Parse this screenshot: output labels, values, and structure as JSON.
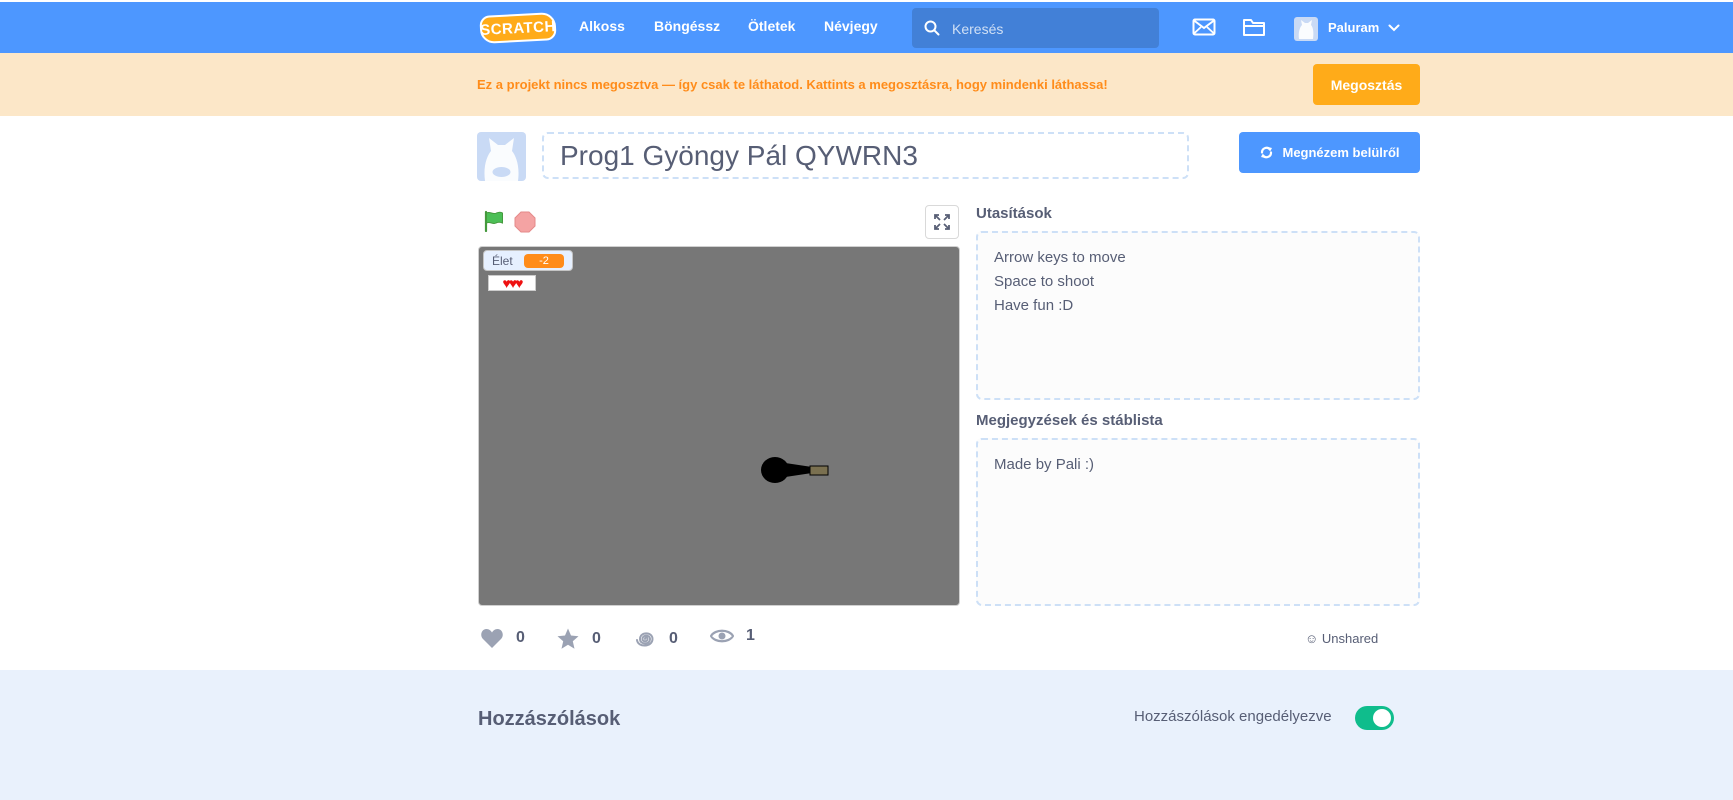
{
  "nav": {
    "logo_text": "SCRATCH",
    "links": [
      "Alkoss",
      "Böngéssz",
      "Ötletek",
      "Névjegy"
    ],
    "search_placeholder": "Keresés",
    "username": "Paluram",
    "icons": [
      "search-icon",
      "mail-icon",
      "folder-icon",
      "chevron-down-icon"
    ]
  },
  "banner": {
    "text": "Ez a projekt nincs megosztva — így csak te láthatod. Kattints a megosztásra, hogy mindenki láthassa!",
    "share_label": "Megosztás"
  },
  "project": {
    "title": "Prog1 Gyöngy Pál QYWRN3",
    "see_inside_label": "Megnézem belülről"
  },
  "stage": {
    "variable_name": "Élet",
    "variable_value": "-2",
    "hearts": "♥♥♥"
  },
  "stats": {
    "loves": "0",
    "favorites": "0",
    "remixes": "0",
    "views": "1",
    "share_status": "☺ Unshared"
  },
  "instructions": {
    "label": "Utasítások",
    "lines": [
      "Arrow keys to move",
      "Space to shoot",
      "Have fun :D"
    ]
  },
  "notes": {
    "label": "Megjegyzések és stáblista",
    "lines": [
      "Made by Pali :)"
    ]
  },
  "comments": {
    "title": "Hozzászólások",
    "toggle_label": "Hozzászólások engedélyezve",
    "toggle_on": true
  },
  "colors": {
    "nav_bg": "#4d97ff",
    "banner_bg": "#fce7c8",
    "banner_text": "#ff8c1a",
    "share_button": "#ffab19",
    "stage_bg": "#777777",
    "toggle_on": "#0fbd8c"
  }
}
